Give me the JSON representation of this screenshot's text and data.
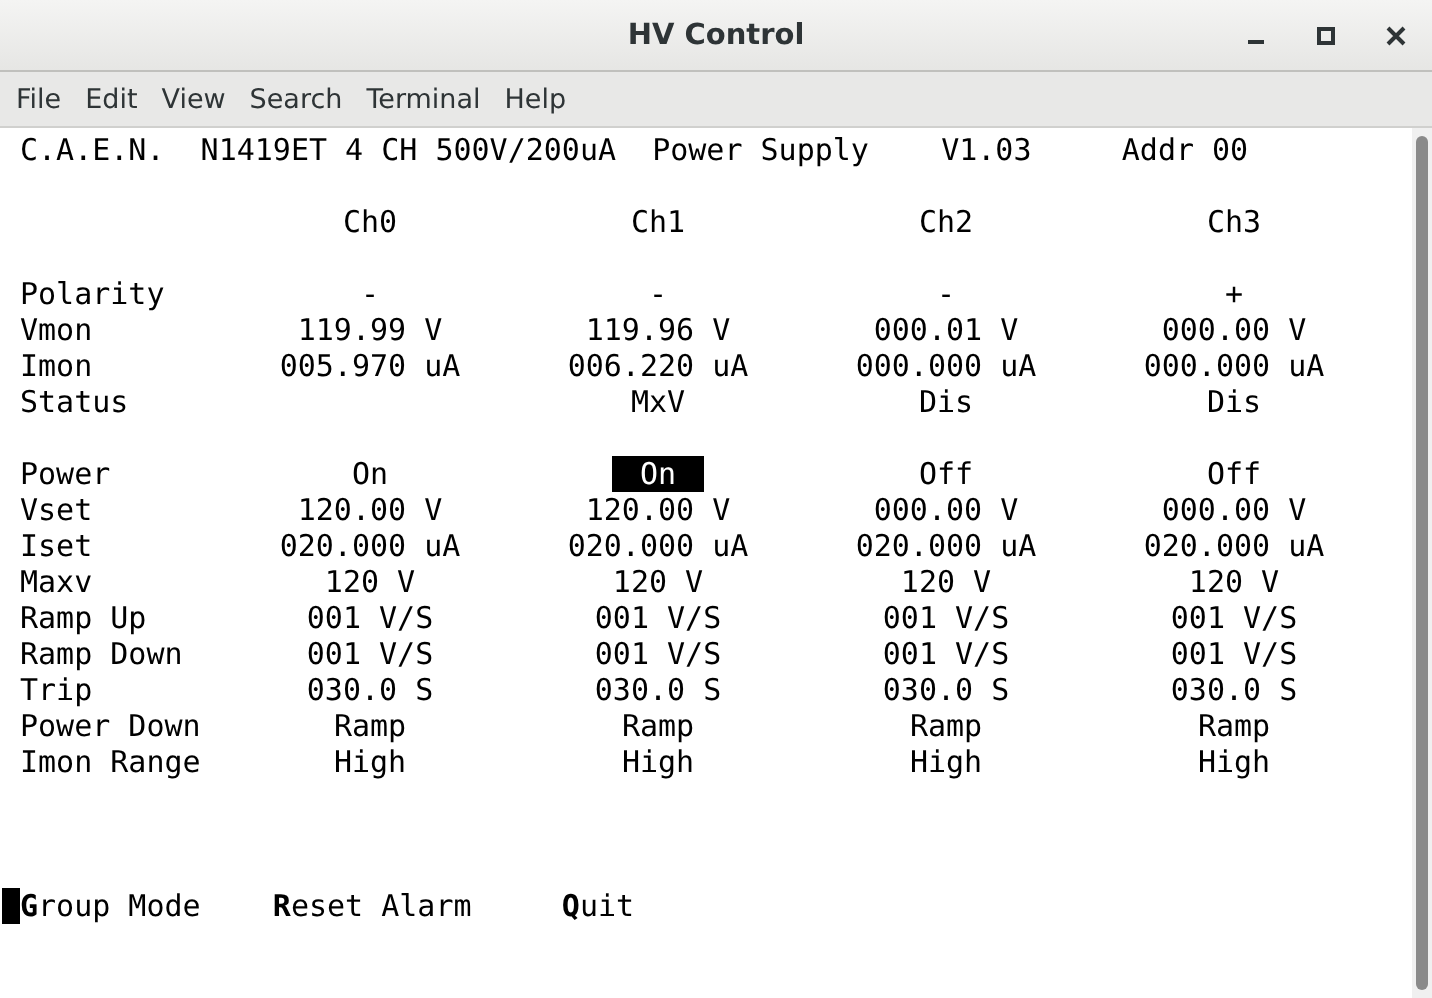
{
  "window": {
    "title": "HV Control"
  },
  "menu": [
    "File",
    "Edit",
    "View",
    "Search",
    "Terminal",
    "Help"
  ],
  "terminal": {
    "header": "C.A.E.N.  N1419ET 4 CH 500V/200uA  Power Supply    V1.03     Addr 00",
    "channels": [
      "Ch0",
      "Ch1",
      "Ch2",
      "Ch3"
    ],
    "groups": [
      [
        {
          "label": "Polarity",
          "values": {
            "ch0": {
              "text": "-"
            },
            "ch1": {
              "text": "-"
            },
            "ch2": {
              "text": "-"
            },
            "ch3": {
              "text": "+"
            }
          }
        },
        {
          "label": "Vmon",
          "values": {
            "ch0": {
              "text": "119.99 V"
            },
            "ch1": {
              "text": "119.96 V"
            },
            "ch2": {
              "text": "000.01 V"
            },
            "ch3": {
              "text": "000.00 V"
            }
          }
        },
        {
          "label": "Imon",
          "values": {
            "ch0": {
              "text": "005.970 uA"
            },
            "ch1": {
              "text": "006.220 uA"
            },
            "ch2": {
              "text": "000.000 uA"
            },
            "ch3": {
              "text": "000.000 uA"
            }
          }
        },
        {
          "label": "Status",
          "values": {
            "ch1": {
              "text": "MxV"
            },
            "ch2": {
              "text": "Dis"
            },
            "ch3": {
              "text": "Dis"
            }
          }
        }
      ],
      [
        {
          "label": "Power",
          "values": {
            "ch0": {
              "text": "On",
              "selected": false
            },
            "ch1": {
              "text": "On",
              "selected": true
            },
            "ch2": {
              "text": "Off",
              "selected": false
            },
            "ch3": {
              "text": "Off",
              "selected": false
            }
          }
        },
        {
          "label": "Vset",
          "values": {
            "ch0": {
              "text": "120.00 V"
            },
            "ch1": {
              "text": "120.00 V"
            },
            "ch2": {
              "text": "000.00 V"
            },
            "ch3": {
              "text": "000.00 V"
            }
          }
        },
        {
          "label": "Iset",
          "values": {
            "ch0": {
              "text": "020.000 uA"
            },
            "ch1": {
              "text": "020.000 uA"
            },
            "ch2": {
              "text": "020.000 uA"
            },
            "ch3": {
              "text": "020.000 uA"
            }
          }
        },
        {
          "label": "Maxv",
          "values": {
            "ch0": {
              "text": "120 V"
            },
            "ch1": {
              "text": "120 V"
            },
            "ch2": {
              "text": "120 V"
            },
            "ch3": {
              "text": "120 V"
            }
          }
        },
        {
          "label": "Ramp Up",
          "values": {
            "ch0": {
              "text": "001 V/S"
            },
            "ch1": {
              "text": "001 V/S"
            },
            "ch2": {
              "text": "001 V/S"
            },
            "ch3": {
              "text": "001 V/S"
            }
          }
        },
        {
          "label": "Ramp Down",
          "values": {
            "ch0": {
              "text": "001 V/S"
            },
            "ch1": {
              "text": "001 V/S"
            },
            "ch2": {
              "text": "001 V/S"
            },
            "ch3": {
              "text": "001 V/S"
            }
          }
        },
        {
          "label": "Trip",
          "values": {
            "ch0": {
              "text": "030.0 S"
            },
            "ch1": {
              "text": "030.0 S"
            },
            "ch2": {
              "text": "030.0 S"
            },
            "ch3": {
              "text": "030.0 S"
            }
          }
        },
        {
          "label": "Power Down",
          "values": {
            "ch0": {
              "text": "Ramp"
            },
            "ch1": {
              "text": "Ramp"
            },
            "ch2": {
              "text": "Ramp"
            },
            "ch3": {
              "text": "Ramp"
            }
          }
        },
        {
          "label": "Imon Range",
          "values": {
            "ch0": {
              "text": "High"
            },
            "ch1": {
              "text": "High"
            },
            "ch2": {
              "text": "High"
            },
            "ch3": {
              "text": "High"
            }
          }
        }
      ]
    ],
    "commands": [
      "**G**roup Mode",
      "**R**eset Alarm",
      "**Q**uit"
    ]
  }
}
